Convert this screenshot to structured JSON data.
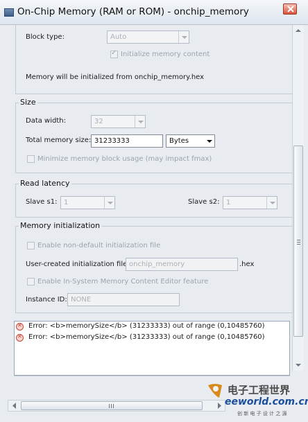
{
  "window": {
    "title": "On-Chip Memory (RAM or ROM) - onchip_memory"
  },
  "block": {
    "block_type_label": "Block type:",
    "block_type_value": "Auto",
    "init_checkbox_label": "Initialize memory content",
    "info_text": "Memory will be initialized from onchip_memory.hex"
  },
  "size": {
    "legend": "Size",
    "data_width_label": "Data width:",
    "data_width_value": "32",
    "total_size_label": "Total memory size:",
    "total_size_value": "31233333",
    "unit_value": "Bytes",
    "minimize_label": "Minimize memory block usage (may impact fmax)"
  },
  "latency": {
    "legend": "Read latency",
    "slave_s1_label": "Slave s1:",
    "slave_s1_value": "1",
    "slave_s2_label": "Slave s2:",
    "slave_s2_value": "1"
  },
  "meminit": {
    "legend": "Memory initialization",
    "non_default_label": "Enable non-default initialization file",
    "user_file_label": "User-created initialization file:",
    "user_file_value": "onchip_memory",
    "file_ext": ".hex",
    "in_system_label": "Enable In-System Memory Content Editor feature",
    "instance_id_label": "Instance ID:",
    "instance_id_value": "NONE"
  },
  "errors": [
    {
      "text": "Error: <b>memorySize</b> (31233333) out of range (0,10485760)"
    },
    {
      "text": "Error: <b>memorySize</b> (31233333) out of range (0,10485760)"
    }
  ],
  "watermark": {
    "cn": "电子工程世界",
    "en": "eeworld.com.cn",
    "sub": "创 新 电 子 设 计 之 源"
  },
  "colors": {
    "background": "#e8ecf1",
    "error_red": "#c9443a",
    "brand_blue": "#1b4f9c"
  }
}
